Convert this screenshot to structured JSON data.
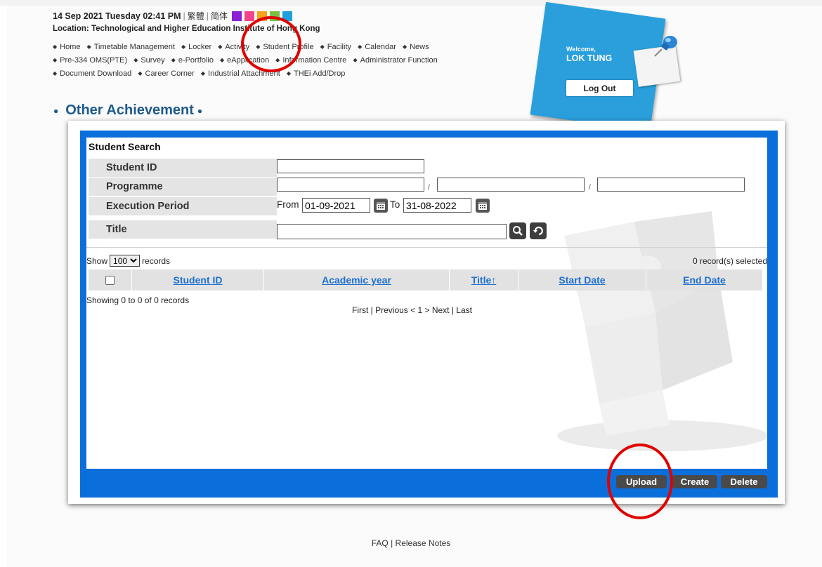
{
  "header": {
    "datetime": "14 Sep 2021 Tuesday 02:41 PM",
    "lang_trad": "繁體",
    "lang_simp": "简体",
    "swatch_colors": [
      "#8a1fd6",
      "#f0458a",
      "#f6a21a",
      "#7ac143",
      "#1ea0dd"
    ],
    "location": "Location: Technological and Higher Education Institute of Hong Kong"
  },
  "nav": {
    "row1": [
      "Home",
      "Timetable Management",
      "Locker",
      "Activity",
      "Student Profile",
      "Facility",
      "Calendar",
      "News"
    ],
    "row2": [
      "Pre-334 OMS(PTE)",
      "Survey",
      "e-Portfolio",
      "eApplication",
      "Information Centre",
      "Administrator Function"
    ],
    "row3": [
      "Document Download",
      "Career Corner",
      "Industrial Attachment",
      "THEi Add/Drop"
    ]
  },
  "welcome": {
    "label": "Welcome,",
    "name": "LOK TUNG",
    "logout": "Log Out"
  },
  "page_title": "Other Achievement",
  "search": {
    "title": "Student Search",
    "fields": {
      "student_id": "Student ID",
      "programme": "Programme",
      "execution_period": "Execution Period",
      "title": "Title"
    },
    "slash": "/",
    "from_label": "From",
    "to_label": "To",
    "from_value": "01-09-2021",
    "to_value": "31-08-2022"
  },
  "list": {
    "show_label": "Show",
    "records_label": "records",
    "page_size": "100",
    "selected_text": "0 record(s) selected",
    "columns": [
      "Student ID",
      "Academic year",
      "Title↑",
      "Start Date",
      "End Date"
    ],
    "showing_text": "Showing 0 to 0 of 0 records",
    "pager_text": "First | Previous < 1 > Next | Last"
  },
  "actions": {
    "upload": "Upload",
    "create": "Create",
    "delete": "Delete"
  },
  "footer": "FAQ  | Release Notes",
  "annotation_color": "#e00000"
}
